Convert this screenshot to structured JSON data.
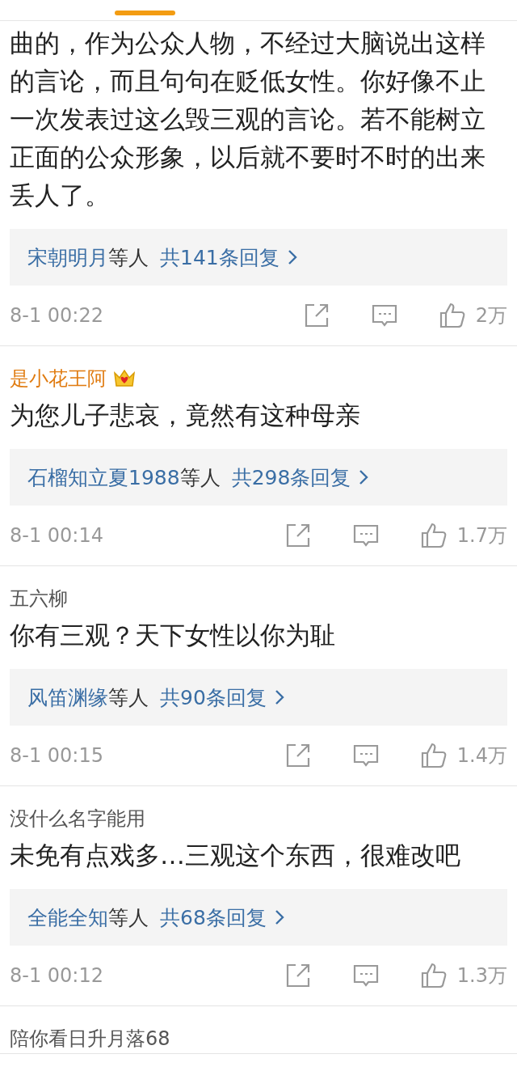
{
  "comments": [
    {
      "text": "曲的，作为公众人物，不经过大脑说出这样的言论，而且句句在贬低女性。你好像不止一次发表过这么毁三观的言论。若不能树立正面的公众形象，以后就不要时不时的出来丢人了。",
      "replies": {
        "names": "宋朝明月",
        "suffix": "等人",
        "count": "共141条回复"
      },
      "time": "8-1 00:22",
      "likes": "2万"
    },
    {
      "author": "是小花王阿",
      "vip": true,
      "text": "为您儿子悲哀，竟然有这种母亲",
      "replies": {
        "names": "石榴知立夏1988",
        "suffix": "等人",
        "count": "共298条回复"
      },
      "time": "8-1 00:14",
      "likes": "1.7万"
    },
    {
      "author": "五六柳",
      "vip": false,
      "text": "你有三观？天下女性以你为耻",
      "replies": {
        "names": "风笛渊缘",
        "suffix": "等人",
        "count": "共90条回复"
      },
      "time": "8-1 00:15",
      "likes": "1.4万"
    },
    {
      "author": "没什么名字能用",
      "vip": false,
      "text": "未免有点戏多…三观这个东西，很难改吧",
      "replies": {
        "names": "全能全知",
        "suffix": "等人",
        "count": "共68条回复"
      },
      "time": "8-1 00:12",
      "likes": "1.3万"
    },
    {
      "author": "陪你看日升月落68",
      "vip": false
    }
  ]
}
